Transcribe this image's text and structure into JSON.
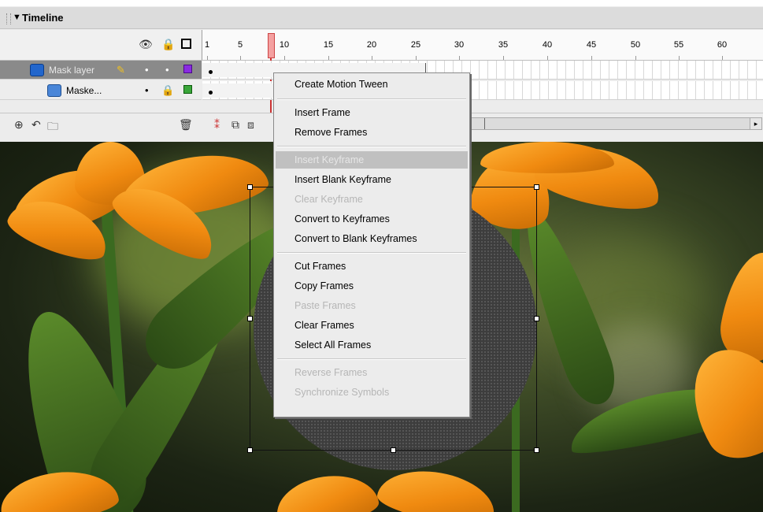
{
  "panel": {
    "title": "Timeline",
    "ruler_ticks": [
      "1",
      "5",
      "10",
      "15",
      "20",
      "25",
      "30",
      "35",
      "40",
      "45",
      "50",
      "55",
      "60"
    ]
  },
  "layers": [
    {
      "name": "Mask layer",
      "selected": true,
      "layer_color": "#8a2be2"
    },
    {
      "name": "Maske...",
      "selected": false,
      "layer_color": "#3aa63a"
    }
  ],
  "colors": {
    "playhead": "#c44444",
    "menu_highlight": "#c0c0c0",
    "petal": "#f08a10"
  },
  "context_menu": {
    "groups": [
      [
        {
          "label": "Create Motion Tween",
          "enabled": true
        }
      ],
      [
        {
          "label": "Insert Frame",
          "enabled": true
        },
        {
          "label": "Remove Frames",
          "enabled": true
        }
      ],
      [
        {
          "label": "Insert Keyframe",
          "enabled": true,
          "highlighted": true
        },
        {
          "label": "Insert Blank Keyframe",
          "enabled": true
        },
        {
          "label": "Clear Keyframe",
          "enabled": false
        },
        {
          "label": "Convert to Keyframes",
          "enabled": true
        },
        {
          "label": "Convert to Blank Keyframes",
          "enabled": true
        }
      ],
      [
        {
          "label": "Cut Frames",
          "enabled": true
        },
        {
          "label": "Copy Frames",
          "enabled": true
        },
        {
          "label": "Paste Frames",
          "enabled": false
        },
        {
          "label": "Clear Frames",
          "enabled": true
        },
        {
          "label": "Select All Frames",
          "enabled": true
        }
      ],
      [
        {
          "label": "Reverse Frames",
          "enabled": false
        },
        {
          "label": "Synchronize Symbols",
          "enabled": false
        }
      ]
    ]
  }
}
